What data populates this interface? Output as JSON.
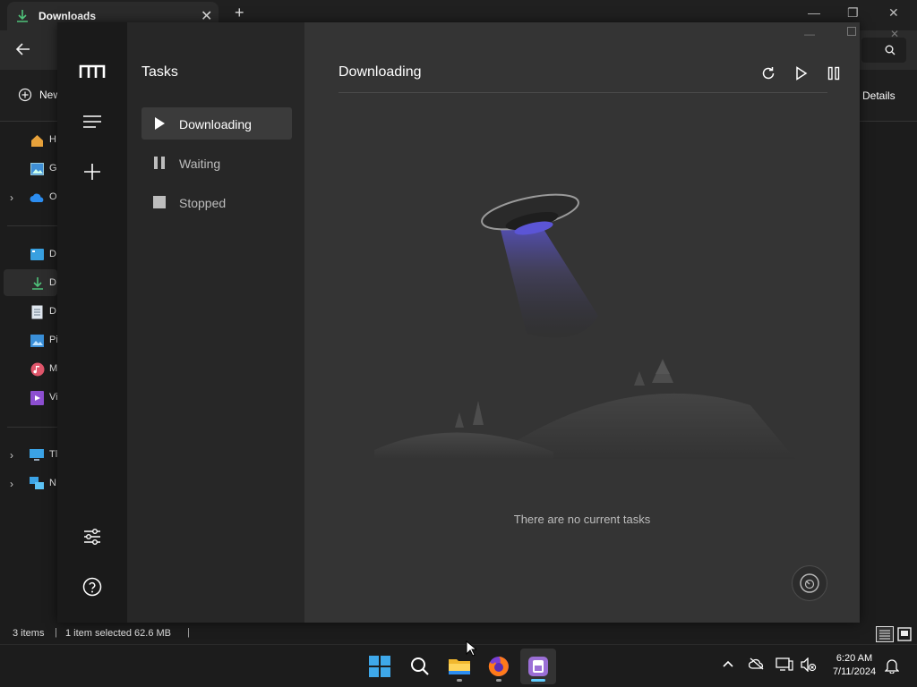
{
  "explorer": {
    "tab_title": "Downloads",
    "new_tab": "+",
    "new_label": "New",
    "details_label": "Details",
    "sidebar": [
      {
        "label": "H",
        "icon": "home-icon"
      },
      {
        "label": "G",
        "icon": "gallery-icon"
      },
      {
        "label": "O",
        "icon": "onedrive-icon",
        "chevron": "›"
      },
      {
        "label": "D",
        "icon": "desktop-icon"
      },
      {
        "label": "D",
        "icon": "download-icon"
      },
      {
        "label": "D",
        "icon": "documents-icon"
      },
      {
        "label": "Pi",
        "icon": "pictures-icon"
      },
      {
        "label": "M",
        "icon": "music-icon"
      },
      {
        "label": "Vi",
        "icon": "videos-icon"
      },
      {
        "label": "Tl",
        "icon": "this-pc-icon",
        "chevron": "›"
      },
      {
        "label": "N",
        "icon": "network-icon",
        "chevron": "›"
      }
    ],
    "status": {
      "items": "3 items",
      "separator": "|",
      "selected": "1 item selected  62.6 MB"
    }
  },
  "app": {
    "name": "Motrix",
    "nav": {
      "title": "Tasks",
      "items": [
        {
          "label": "Downloading",
          "icon": "play-icon",
          "active": true
        },
        {
          "label": "Waiting",
          "icon": "pause-icon",
          "active": false
        },
        {
          "label": "Stopped",
          "icon": "stop-icon",
          "active": false
        }
      ]
    },
    "main": {
      "title": "Downloading",
      "empty_message": "There are no current tasks"
    },
    "colors": {
      "rail": "#1a1a1a",
      "panel": "#272727",
      "main": "#343434",
      "active_item": "#3b3b3b",
      "ufo_beam": "#5b55d6"
    }
  },
  "taskbar": {
    "time": "6:20 AM",
    "date": "7/11/2024",
    "apps": [
      "start-icon",
      "search-icon",
      "file-explorer-icon",
      "firefox-icon",
      "motrix-icon"
    ]
  }
}
